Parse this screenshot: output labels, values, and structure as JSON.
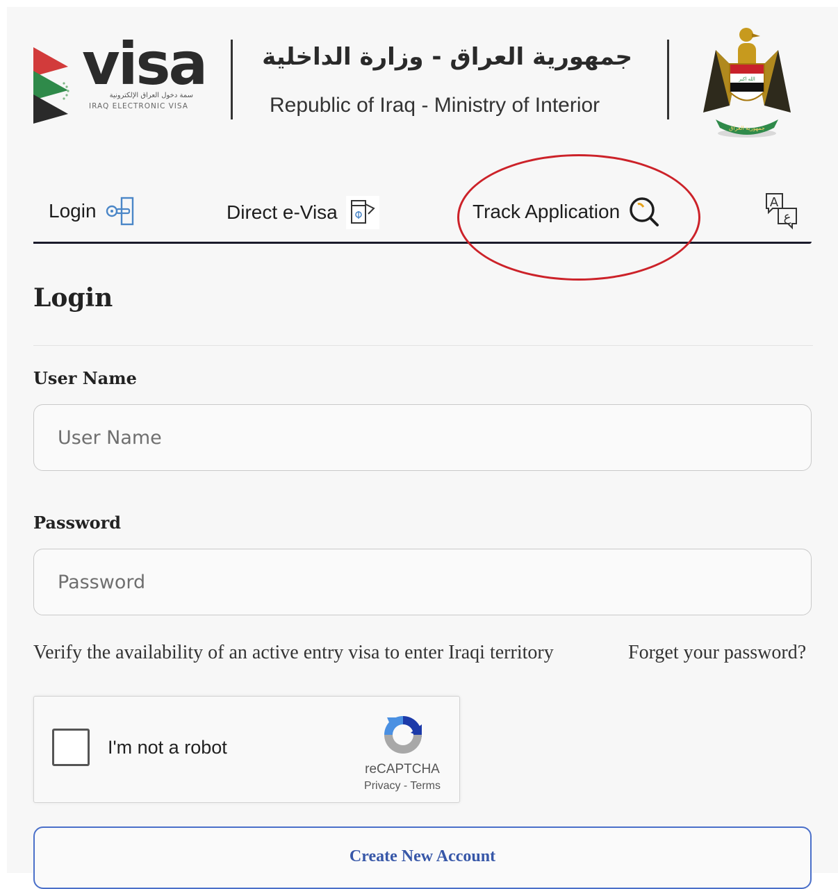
{
  "header": {
    "logo_word": "visa",
    "logo_ar": "سمة دخول العراق الإلكترونية",
    "logo_en": "IRAQ ELECTRONIC VISA",
    "gov_title_ar": "جمهورية العراق - وزارة الداخلية",
    "gov_title_en": "Republic of Iraq  - Ministry of Interior",
    "emblem_icon": "iraq-eagle-emblem-icon"
  },
  "tabs": [
    {
      "label": "Login",
      "icon": "key-login-icon"
    },
    {
      "label": "Direct e-Visa",
      "icon": "passport-document-icon"
    },
    {
      "label": "Track Application",
      "icon": "search-icon"
    }
  ],
  "language_icon": "language-toggle-icon",
  "annotation_color": "#cc2229",
  "form": {
    "heading": "Login",
    "username_label": "User Name",
    "username_placeholder": "User Name",
    "password_label": "Password",
    "password_placeholder": "Password",
    "verify_link": "Verify the availability of an active entry visa to enter Iraqi territory",
    "forgot_link": "Forget your password?",
    "create_account": "Create New Account"
  },
  "recaptcha": {
    "label": "I'm not a robot",
    "brand": "reCAPTCHA",
    "terms": "Privacy - Terms"
  }
}
